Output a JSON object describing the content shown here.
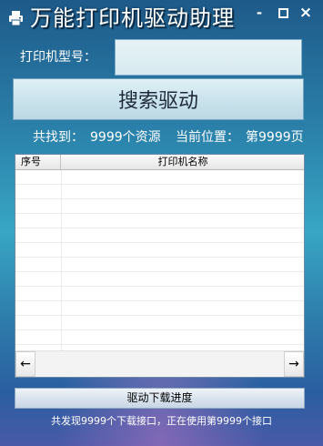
{
  "window": {
    "title": "万能打印机驱动助理",
    "icon": "printer-icon",
    "minimize_glyph": "-",
    "close_glyph": "×"
  },
  "model": {
    "label": "打印机型号：",
    "value": "",
    "placeholder": ""
  },
  "search": {
    "label": "搜索驱动"
  },
  "stats": {
    "found_label": "共找到：",
    "found_value": "9999个资源",
    "page_label": "当前位置：",
    "page_value": "第9999页"
  },
  "table": {
    "columns": [
      "序号",
      "打印机名称"
    ],
    "rows": [],
    "scroll_left": "←",
    "scroll_right": "→"
  },
  "progress": {
    "label": "驱动下载进度",
    "fraction": 0
  },
  "status": {
    "text": "共发现9999个下载接口，正在使用第9999个接口"
  },
  "colors": {
    "title_text": "#ffffff",
    "button_bg": "#c9e2ec",
    "background_top": "#1e5a8a",
    "background_mid": "#38a6c4"
  }
}
